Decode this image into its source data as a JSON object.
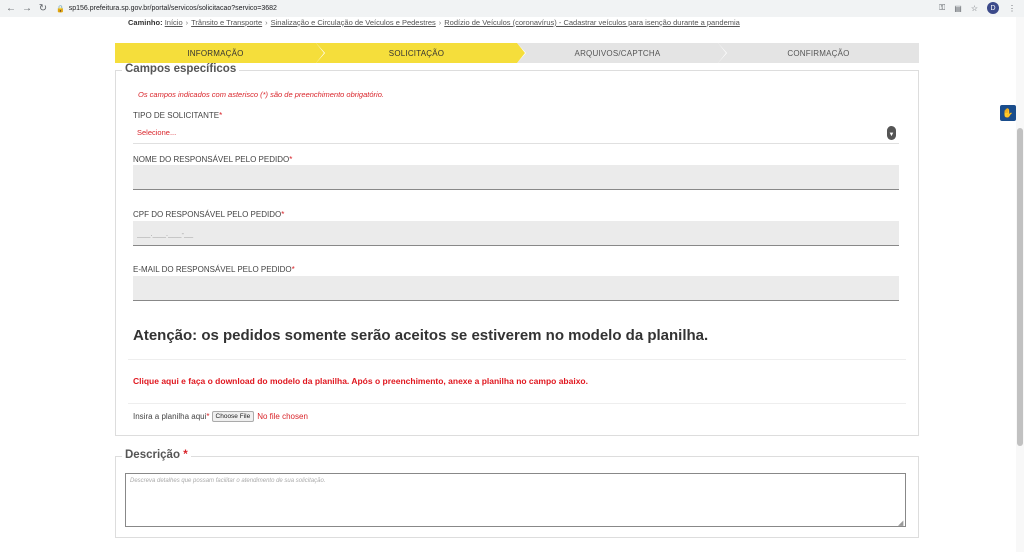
{
  "browser": {
    "url": "sp156.prefeitura.sp.gov.br/portal/servicos/solicitacao?servico=3682",
    "profile_initial": "D"
  },
  "breadcrumb": {
    "label": "Caminho:",
    "items": [
      "Início",
      "Trânsito e Transporte",
      "Sinalização e Circulação de Veículos e Pedestres",
      "Rodízio de Veículos (coronavírus) - Cadastrar veículos para isenção durante a pandemia"
    ]
  },
  "steps": [
    {
      "label": "INFORMAÇÃO",
      "state": "done"
    },
    {
      "label": "SOLICITAÇÃO",
      "state": "active"
    },
    {
      "label": "ARQUIVOS/CAPTCHA",
      "state": "pending"
    },
    {
      "label": "CONFIRMAÇÃO",
      "state": "pending"
    }
  ],
  "campos": {
    "legend": "Campos específicos",
    "required_note": "Os campos indicados com asterisco (*) são de preenchimento obrigatório.",
    "tipo_label": "TIPO DE SOLICITANTE",
    "tipo_selected": "Selecione...",
    "nome_label": "NOME DO RESPONSÁVEL PELO PEDIDO",
    "nome_value": "",
    "cpf_label": "CPF DO RESPONSÁVEL PELO PEDIDO",
    "cpf_placeholder": "___.___.___-__",
    "email_label": "E-MAIL DO RESPONSÁVEL PELO PEDIDO",
    "email_value": "",
    "asterisk": "*"
  },
  "attention": "Atenção: os pedidos somente serão aceitos se estiverem no modelo da planilha.",
  "download_link": "Clique aqui e faça o download do modelo da planilha. Após o preenchimento, anexe a planilha no campo abaixo.",
  "file": {
    "label": "Insira a planilha aqui",
    "button": "Choose File",
    "status": "No file chosen"
  },
  "descricao": {
    "legend": "Descrição",
    "placeholder": "Descreva detalhes que possam facilitar o atendimento de sua solicitação."
  },
  "colors": {
    "step_active": "#f5de3b",
    "step_inactive": "#e4e4e4",
    "required": "#d9242a",
    "link_red": "#e0171f"
  }
}
